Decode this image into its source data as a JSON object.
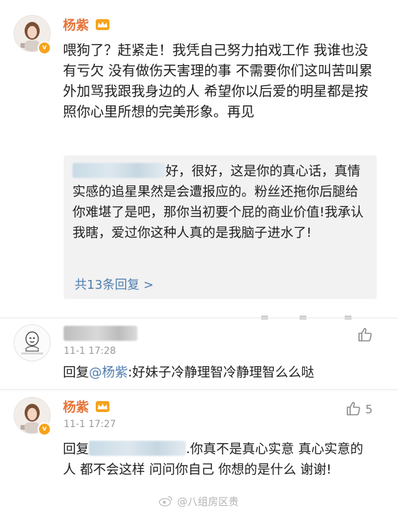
{
  "post": {
    "author": "杨紫",
    "text": "喂狗了？赶紧走！我凭自己努力拍戏工作 我谁也没有亏欠 没有做伤天害理的事 不需要你们这叫苦叫累外加骂我跟我身边的人 希望你以后爱的明星都是按照你心里所想的完美形象。再见"
  },
  "quoted": {
    "text_after_name": "好，很好，这是你的真心话，",
    "text_rest": "真情实感的追星果然是会遭报应的。粉丝还拖你后腿给你难堪了是吧，那你当初要个屁的商业价值!我承认我瞎，爱过你这种人真的是我脑子进水了!",
    "replies_link": "共13条回复 >"
  },
  "comments": [
    {
      "time": "11-1 17:28",
      "reply_prefix": "回复",
      "mention": "@杨紫",
      "reply_text": ":好妹子冷静理智冷静理智么么哒"
    },
    {
      "author": "杨紫",
      "time": "11-1 17:27",
      "likes": "5",
      "reply_prefix": "回复",
      "reply_text": ".你真不是真心实意 真心实意的人 都不会这样 问问你自己 你想的是什么 谢谢!"
    }
  ],
  "watermark": "@八组房区贵",
  "icons": {
    "verified": "verified-badge-icon",
    "crown": "crown-icon",
    "like": "thumbs-up-icon"
  },
  "colors": {
    "name": "#e6753a",
    "link": "#507daf",
    "verified": "#f7a21b"
  }
}
